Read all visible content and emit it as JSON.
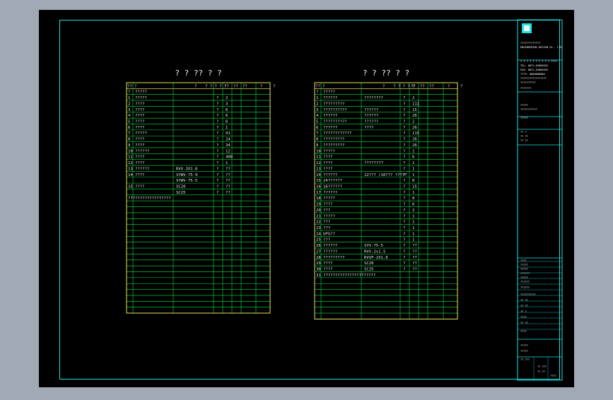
{
  "colors": {
    "background": "#a1a9b5",
    "canvas": "#000000",
    "frame": "#19e2e2",
    "table_outer": "#ffff66",
    "table_grid": "#00e640",
    "text": "#e8e8e8"
  },
  "left_table": {
    "title": "? ? ?? ? ?",
    "header": [
      "??",
      "?",
      "?",
      "? ? ? ? ?",
      "??",
      "??",
      "??",
      "?",
      "?"
    ],
    "rows": [
      {
        "no": "?",
        "name": "?????",
        "model": "",
        "unit": "",
        "qty": ""
      },
      {
        "no": "1",
        "name": "?????",
        "model": "",
        "unit": "?",
        "qty": "2"
      },
      {
        "no": "2",
        "name": "????",
        "model": "",
        "unit": "?",
        "qty": "3"
      },
      {
        "no": "3",
        "name": "????",
        "model": "",
        "unit": "?",
        "qty": "6"
      },
      {
        "no": "4",
        "name": "????",
        "model": "",
        "unit": "?",
        "qty": "6"
      },
      {
        "no": "5",
        "name": "????",
        "model": "",
        "unit": "?",
        "qty": "6"
      },
      {
        "no": "6",
        "name": "????",
        "model": "",
        "unit": "?",
        "qty": "1"
      },
      {
        "no": "7",
        "name": "?????",
        "model": "",
        "unit": "?",
        "qty": "91"
      },
      {
        "no": "8",
        "name": "????",
        "model": "",
        "unit": "?",
        "qty": "24"
      },
      {
        "no": "9",
        "name": "????",
        "model": "",
        "unit": "?",
        "qty": "34"
      },
      {
        "no": "10",
        "name": "??????",
        "model": "",
        "unit": "?",
        "qty": "12"
      },
      {
        "no": "11",
        "name": "????",
        "model": "",
        "unit": "?",
        "qty": "400"
      },
      {
        "no": "12",
        "name": "????",
        "model": "",
        "unit": "?",
        "qty": "1"
      },
      {
        "no": "13",
        "name": "??????",
        "model": "RVV-3X1.0",
        "unit": "?",
        "qty": "??"
      },
      {
        "no": "14",
        "name": "????",
        "model": "SYWV-75-9",
        "unit": "?",
        "qty": "??"
      },
      {
        "no": "",
        "name": "",
        "model": "SYWV-75-5",
        "unit": "?",
        "qty": "??"
      },
      {
        "no": "15",
        "name": "????",
        "model": "SC20",
        "unit": "?",
        "qty": "??"
      },
      {
        "no": "",
        "name": "",
        "model": "SC25",
        "unit": "?",
        "qty": "??"
      }
    ],
    "note": "??????????????????"
  },
  "right_table": {
    "title": "? ? ?? ? ?",
    "header": [
      "??",
      "?",
      "?",
      "? ? ? ? ?",
      "??",
      "??",
      "??",
      "?",
      "?"
    ],
    "rows": [
      {
        "no": "?",
        "name": "?????",
        "model": "",
        "unit": "",
        "qty": ""
      },
      {
        "no": "1",
        "name": "??????",
        "model": "????????",
        "unit": "?",
        "qty": "2"
      },
      {
        "no": "2",
        "name": "?????????",
        "model": "",
        "unit": "?",
        "qty": "111"
      },
      {
        "no": "3",
        "name": "??????????",
        "model": "??????",
        "unit": "?",
        "qty": "15"
      },
      {
        "no": "4",
        "name": "??????",
        "model": "??????",
        "unit": "?",
        "qty": "26"
      },
      {
        "no": "5",
        "name": "??????????",
        "model": "??????",
        "unit": "?",
        "qty": "2"
      },
      {
        "no": "6",
        "name": "??????",
        "model": "????",
        "unit": "?",
        "qty": "26"
      },
      {
        "no": "7",
        "name": "????????????",
        "model": "",
        "unit": "?",
        "qty": "115"
      },
      {
        "no": "8",
        "name": "?????????",
        "model": "",
        "unit": "?",
        "qty": "26"
      },
      {
        "no": "9",
        "name": "?????????",
        "model": "",
        "unit": "?",
        "qty": "26"
      },
      {
        "no": "10",
        "name": "?????",
        "model": "",
        "unit": "?",
        "qty": "2"
      },
      {
        "no": "11",
        "name": "????",
        "model": "",
        "unit": "?",
        "qty": "6"
      },
      {
        "no": "12",
        "name": "????",
        "model": "????????",
        "unit": "?",
        "qty": "1"
      },
      {
        "no": "13",
        "name": "????",
        "model": "",
        "unit": "?",
        "qty": "1"
      },
      {
        "no": "14",
        "name": "??????",
        "model": "12??? /16??? ?????",
        "unit": "?",
        "qty": "1"
      },
      {
        "no": "15",
        "name": "24??????",
        "model": "",
        "unit": "?",
        "qty": "8"
      },
      {
        "no": "16",
        "name": "16??????",
        "model": "",
        "unit": "?",
        "qty": "15"
      },
      {
        "no": "17",
        "name": "??????",
        "model": "",
        "unit": "?",
        "qty": "1"
      },
      {
        "no": "18",
        "name": "?????",
        "model": "",
        "unit": "?",
        "qty": "8"
      },
      {
        "no": "19",
        "name": "????",
        "model": "",
        "unit": "?",
        "qty": "6"
      },
      {
        "no": "20",
        "name": "???",
        "model": "",
        "unit": "?",
        "qty": "2"
      },
      {
        "no": "21",
        "name": "?????",
        "model": "",
        "unit": "?",
        "qty": "1"
      },
      {
        "no": "22",
        "name": "???",
        "model": "",
        "unit": "?",
        "qty": "1"
      },
      {
        "no": "23",
        "name": "???",
        "model": "",
        "unit": "?",
        "qty": "1"
      },
      {
        "no": "24",
        "name": "UPS??",
        "model": "",
        "unit": "?",
        "qty": "1"
      },
      {
        "no": "25",
        "name": "???",
        "model": "",
        "unit": "?",
        "qty": "1"
      },
      {
        "no": "26",
        "name": "??????",
        "model": "SYV-75-5",
        "unit": "?",
        "qty": "??"
      },
      {
        "no": "27",
        "name": "??????",
        "model": "RVV-2x1.5",
        "unit": "?",
        "qty": "??"
      },
      {
        "no": "28",
        "name": "?????????",
        "model": "RVVP-2X1.0",
        "unit": "?",
        "qty": "??"
      },
      {
        "no": "29",
        "name": "????",
        "model": "SC20",
        "unit": "?",
        "qty": "??"
      },
      {
        "no": "30",
        "name": "????",
        "model": "SC25",
        "unit": "?",
        "qty": "??"
      }
    ],
    "note": "31  ??????????????????????"
  },
  "title_block": {
    "lines": [
      "?????????????",
      "ENGINEERING DESIGN CO., LTD.",
      "? ? ? ? ? ? ? ? ? ? ????",
      "TEL: 0871-63605035",
      "FAX: 0871-63605035",
      "????: 0000000000",
      "?????????????????",
      "??????????",
      "???????",
      "?????",
      "???????????",
      "?????",
      "?? ?",
      "?? ??",
      "?? ??",
      "????",
      "?????",
      "?????",
      "??????",
      "?????",
      "??????",
      "??????",
      "??????????",
      "?? ??",
      "?? ??",
      "?? ?",
      "????",
      "?? ??",
      "????",
      "?????",
      "?????",
      "?? ???"
    ],
    "sheet_no": "?? ???",
    "date": "??-??",
    "page": "????"
  }
}
